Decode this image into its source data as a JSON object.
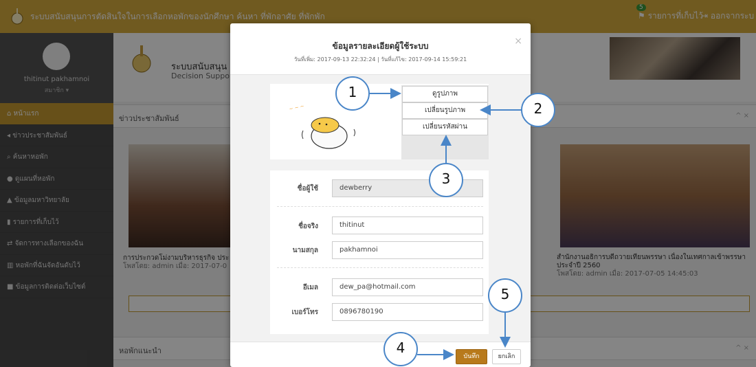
{
  "topbar": {
    "app_title": "ระบบสนับสนุนการตัดสินใจในการเลือกหอพักของนักศึกษา ค้นหา ที่พักอาศัย ที่พักพัก",
    "bookmark_count": "5",
    "bookmark_label": "รายการที่เก็บไว้",
    "logout_label": "ออกจากระบ"
  },
  "sidebar": {
    "user_name": "thitinut pakhamnoi",
    "user_role": "สมาชิก ▾",
    "items": [
      {
        "label": "หน้าแรก"
      },
      {
        "label": "ข่าวประชาสัมพันธ์"
      },
      {
        "label": "ค้นหาหอพัก"
      },
      {
        "label": "ดูแผนที่หอพัก"
      },
      {
        "label": "ข้อมูลมหาวิทยาลัย"
      },
      {
        "label": "รายการที่เก็บไว้"
      },
      {
        "label": "จัดการทางเลือกของฉัน"
      },
      {
        "label": "หอพักที่ฉันจัดอันดับไว้"
      },
      {
        "label": "ข้อมูลการติดต่อเว็บไซต์"
      }
    ]
  },
  "content": {
    "org_name": "ระบบสนับสนุน",
    "org_sub": "Decision Support",
    "news_heading": "ข่าวประชาสัมพันธ์",
    "recommend_heading": "หอพักแนะนำ",
    "news": [
      {
        "caption": "การประกวดโม่งามบริหารธุรกิจ ประ",
        "meta": "โพสโดย: admin เมื่อ: 2017-07-0"
      },
      {
        "caption": "สำนักงานอธิการบดีถวายเทียนพรรษา เนื่องในเทศกาลเข้าพรรษา",
        "caption2": "ประจำปี 2560",
        "meta": "โพสโดย: admin เมื่อ: 2017-07-05 14:45:03"
      }
    ]
  },
  "modal": {
    "title": "ข้อมูลรายละเอียดผู้ใช้ระบบ",
    "dates": "วันที่เพิ่ม: 2017-09-13 22:32:24 | วันที่แก้ไข: 2017-09-14 15:59:21",
    "close": "×",
    "photo_buttons": {
      "view": "ดูรูปภาพ",
      "change": "เปลี่ยนรูปภาพ",
      "change_password": "เปลี่ยนรหัสผ่าน"
    },
    "fields": {
      "username": {
        "label": "ชื่อผู้ใช้",
        "value": "dewberry"
      },
      "first_name": {
        "label": "ชื่อจริง",
        "value": "thitinut"
      },
      "last_name": {
        "label": "นามสกุล",
        "value": "pakhamnoi"
      },
      "email": {
        "label": "อีเมล",
        "value": "dew_pa@hotmail.com"
      },
      "phone": {
        "label": "เบอร์โทร",
        "value": "0896780190"
      }
    },
    "save_label": "บันทึก",
    "cancel_label": "ยกเลิก"
  },
  "callouts": [
    "1",
    "2",
    "3",
    "4",
    "5"
  ],
  "colors": {
    "brand_gold": "#d7ac3f",
    "sidebar": "#4a4a4a",
    "save_button": "#b87a1c",
    "callout_blue": "#4a86c8"
  }
}
